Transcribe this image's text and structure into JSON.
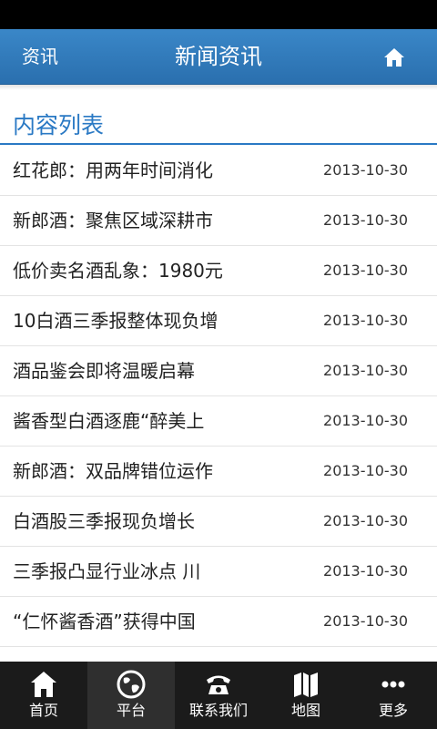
{
  "header": {
    "back_label": "资讯",
    "title": "新闻资讯",
    "home_icon": "home-icon"
  },
  "section": {
    "title": "内容列表"
  },
  "items": [
    {
      "title": "红花郎：用两年时间消化",
      "date": "2013-10-30"
    },
    {
      "title": "新郎酒：聚焦区域深耕市",
      "date": "2013-10-30"
    },
    {
      "title": "低价卖名酒乱象：1980元",
      "date": "2013-10-30"
    },
    {
      "title": "10白酒三季报整体现负增",
      "date": "2013-10-30"
    },
    {
      "title": "酒品鉴会即将温暖启幕",
      "date": "2013-10-30"
    },
    {
      "title": "酱香型白酒逐鹿“醉美上",
      "date": "2013-10-30"
    },
    {
      "title": "新郎酒：双品牌错位运作",
      "date": "2013-10-30"
    },
    {
      "title": "白酒股三季报现负增长",
      "date": "2013-10-30"
    },
    {
      "title": "三季报凸显行业冰点 川",
      "date": "2013-10-30"
    },
    {
      "title": "“仁怀酱香酒”获得中国",
      "date": "2013-10-30"
    }
  ],
  "tabbar": {
    "tabs": [
      {
        "label": "首页",
        "icon": "home-icon"
      },
      {
        "label": "平台",
        "icon": "globe-icon"
      },
      {
        "label": "联系我们",
        "icon": "phone-icon"
      },
      {
        "label": "地图",
        "icon": "map-icon"
      },
      {
        "label": "更多",
        "icon": "more-icon"
      }
    ],
    "active_index": 1
  },
  "colors": {
    "header": "#2f7bbd",
    "accent": "#2a79c4",
    "tabbar": "#1b1b1b"
  }
}
